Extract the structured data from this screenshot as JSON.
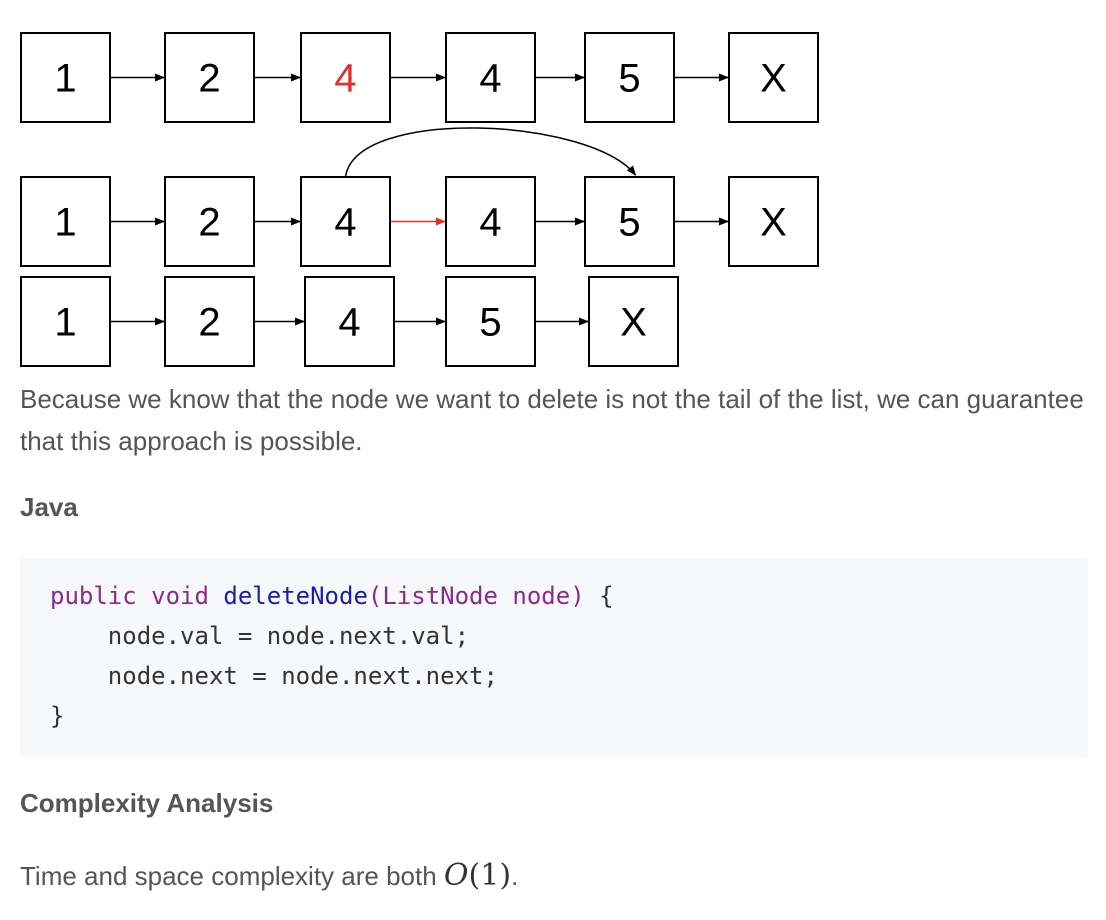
{
  "diagram": {
    "rows": [
      {
        "nodes": [
          "1",
          "2",
          "4",
          "4",
          "5",
          "X"
        ],
        "highlight_index": 2,
        "highlight_color": "#e0302b"
      },
      {
        "nodes": [
          "1",
          "2",
          "4",
          "4",
          "5",
          "X"
        ],
        "red_link_index": 2,
        "red_link_color": "#e0302b",
        "bypass": {
          "from": 2,
          "to": 4
        }
      },
      {
        "nodes": [
          "1",
          "2",
          "4",
          "5",
          "X"
        ]
      }
    ]
  },
  "paragraph": "Because we know that the node we want to delete is not the tail of the list, we can guarantee that this approach is possible.",
  "java_heading": "Java",
  "code": {
    "line1": {
      "kw_public": "public",
      "kw_void": "void",
      "fn_name": "deleteNode",
      "paren_open": "(",
      "type": "ListNode",
      "param": "node",
      "paren_close": ")",
      "brace": " {"
    },
    "line2": "    node.val = node.next.val;",
    "line3": "    node.next = node.next.next;",
    "line4": "}"
  },
  "complexity_heading": "Complexity Analysis",
  "complexity_text": "Time and space complexity are both ",
  "complexity_math": {
    "func": "O",
    "open": "(",
    "arg": "1",
    "close": ")"
  },
  "complexity_end": "."
}
